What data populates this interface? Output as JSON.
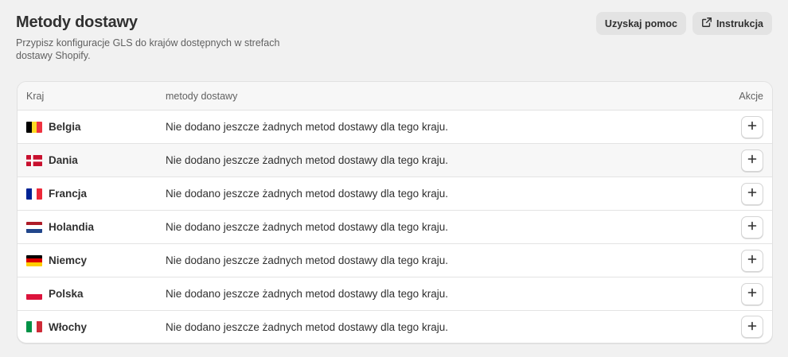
{
  "header": {
    "title": "Metody dostawy",
    "subtitle": "Przypisz konfiguracje GLS do krajów dostępnych w strefach dostawy Shopify.",
    "help_label": "Uzyskaj pomoc",
    "instructions_label": "Instrukcja",
    "instructions_icon": "external-link-icon"
  },
  "table": {
    "columns": [
      "Kraj",
      "metody dostawy",
      "Akcje"
    ],
    "rows": [
      {
        "country": "Belgia",
        "flag": "be-flag-icon",
        "message": "Nie dodano jeszcze żadnych metod dostawy dla tego kraju."
      },
      {
        "country": "Dania",
        "flag": "dk-flag-icon",
        "message": "Nie dodano jeszcze żadnych metod dostawy dla tego kraju."
      },
      {
        "country": "Francja",
        "flag": "fr-flag-icon",
        "message": "Nie dodano jeszcze żadnych metod dostawy dla tego kraju."
      },
      {
        "country": "Holandia",
        "flag": "nl-flag-icon",
        "message": "Nie dodano jeszcze żadnych metod dostawy dla tego kraju."
      },
      {
        "country": "Niemcy",
        "flag": "de-flag-icon",
        "message": "Nie dodano jeszcze żadnych metod dostawy dla tego kraju."
      },
      {
        "country": "Polska",
        "flag": "pl-flag-icon",
        "message": "Nie dodano jeszcze żadnych metod dostawy dla tego kraju."
      },
      {
        "country": "Włochy",
        "flag": "it-flag-icon",
        "message": "Nie dodano jeszcze żadnych metod dostawy dla tego kraju."
      }
    ],
    "add_icon": "plus-icon"
  },
  "colors": {
    "background": "#f1f1f1",
    "card": "#ffffff",
    "button": "#e3e3e3",
    "text": "#303030",
    "muted": "#616161"
  }
}
